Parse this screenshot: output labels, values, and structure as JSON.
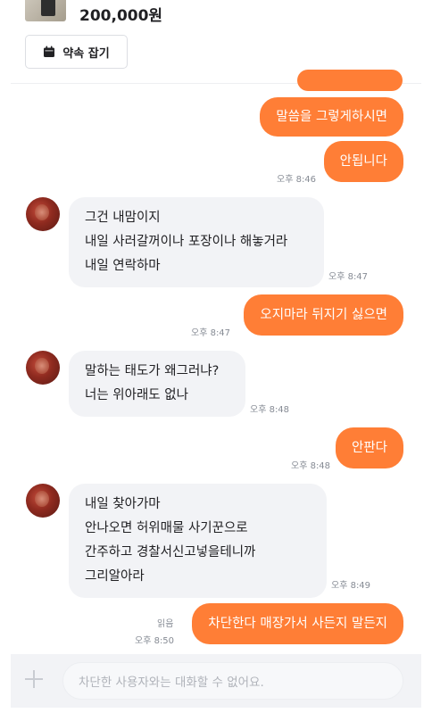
{
  "product": {
    "price": "200,000원"
  },
  "appointment_button": {
    "label": "약속 잡기",
    "icon": "calendar-icon"
  },
  "messages": [
    {
      "sender": "me",
      "text": "말씀을 그렇게하시면"
    },
    {
      "sender": "me",
      "text": "안됩니다",
      "time": "오후 8:46"
    },
    {
      "sender": "other",
      "text": "그건 내맘이지\n 내일 사러갈꺼이나 포장이나 해놓거라\n내일 연락하마",
      "time": "오후 8:47"
    },
    {
      "sender": "me",
      "text": "오지마라 뒤지기 싫으면",
      "time": "오후 8:47"
    },
    {
      "sender": "other",
      "text": "말하는 태도가 왜그러냐?\n너는 위아래도 없나",
      "time": "오후 8:48"
    },
    {
      "sender": "me",
      "text": "안판다",
      "time": "오후 8:48"
    },
    {
      "sender": "other",
      "text": "내일 찾아가마\n안나오면 허위매물 사기꾼으로\n간주하고 경찰서신고넣을테니까\n그리알아라",
      "time": "오후 8:49"
    },
    {
      "sender": "me",
      "text": "차단한다 매장가서 사든지 말든지",
      "time": "오후 8:50",
      "status": "읽음"
    }
  ],
  "input": {
    "placeholder": "차단한 사용자와는 대화할 수 없어요."
  },
  "colors": {
    "accent": "#ff7e36",
    "other_bubble": "#f2f3f6",
    "timestamp": "#868b94"
  }
}
